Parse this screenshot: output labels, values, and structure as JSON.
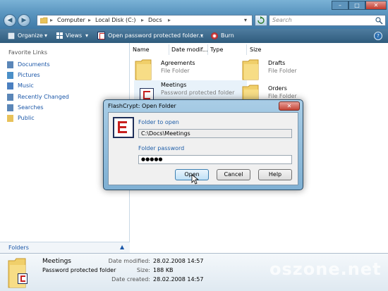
{
  "window": {
    "minimize": "–",
    "maximize": "□",
    "close": "✕"
  },
  "address": {
    "segments": [
      "Computer",
      "Local Disk (C:)",
      "Docs"
    ],
    "separator": "▸"
  },
  "search": {
    "placeholder": "Search"
  },
  "toolbar": {
    "organize": "Organize",
    "views": "Views",
    "open_protected": "Open password protected folder...",
    "burn": "Burn",
    "help": "?"
  },
  "nav": {
    "header": "Favorite Links",
    "items": [
      {
        "label": "Documents",
        "icon": "documents-icon",
        "color": "#5a86b8"
      },
      {
        "label": "Pictures",
        "icon": "pictures-icon",
        "color": "#4a8fc8"
      },
      {
        "label": "Music",
        "icon": "music-icon",
        "color": "#4a7fc0"
      },
      {
        "label": "Recently Changed",
        "icon": "recent-icon",
        "color": "#5a86b8"
      },
      {
        "label": "Searches",
        "icon": "searches-icon",
        "color": "#5a86b8"
      },
      {
        "label": "Public",
        "icon": "public-folder-icon",
        "color": "#e8c25a"
      }
    ],
    "folders_label": "Folders"
  },
  "columns": [
    "Name",
    "Date modif...",
    "Type",
    "Size"
  ],
  "files": [
    {
      "name": "Agreements",
      "type": "File Folder"
    },
    {
      "name": "Drafts",
      "type": "File Folder"
    },
    {
      "name": "Meetings",
      "type": "Password protected folder"
    },
    {
      "name": "Orders",
      "type": "File Folder"
    }
  ],
  "details": {
    "name": "Meetings",
    "type": "Password protected folder",
    "modified_label": "Date modified:",
    "modified": "28.02.2008 14:57",
    "size_label": "Size:",
    "size": "188 KB",
    "created_label": "Date created:",
    "created": "28.02.2008 14:57"
  },
  "dialog": {
    "title": "FlashCrypt: Open Folder",
    "folder_caption": "Folder to open",
    "folder_value": "C:\\Docs\\Meetings",
    "password_caption": "Folder password",
    "password_value": "●●●●●",
    "open": "Open",
    "cancel": "Cancel",
    "help": "Help"
  },
  "watermark": "oszone.net",
  "colors": {
    "link": "#1b57a8",
    "accent": "#1f5ea8",
    "logo_red": "#c8201e",
    "logo_navy": "#1f2e59"
  }
}
